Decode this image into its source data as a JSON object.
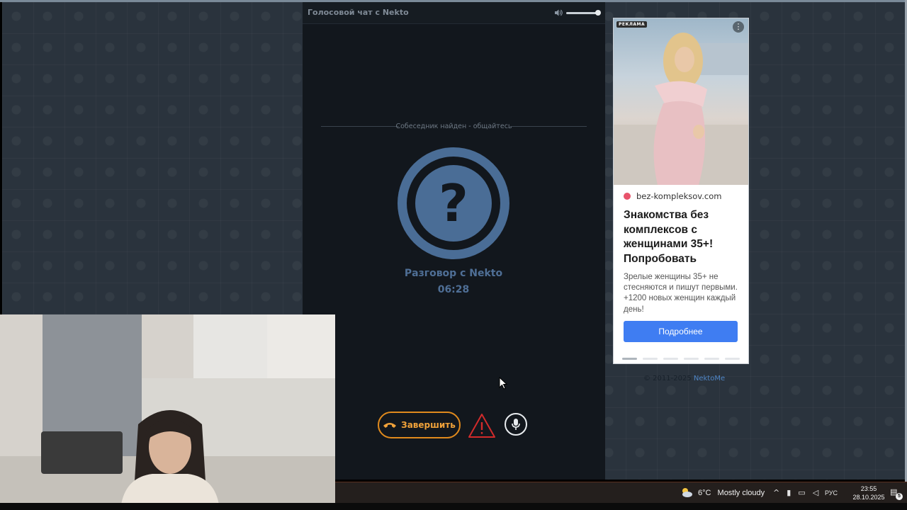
{
  "chat": {
    "title": "Голосовой чат с Nekto",
    "status": "Собеседник найден - общайтесь",
    "avatar_symbol": "?",
    "conversation_title": "Разговор с Nekto",
    "timer": "06:28",
    "volume": 0.9,
    "end_button": "Завершить",
    "accent_color": "#4f6f96",
    "end_color": "#e08a1d",
    "warn_color": "#d12b2b"
  },
  "ad": {
    "label": "РЕКЛАМА",
    "domain": "bez-kompleksov.com",
    "headline": "Знакомства без комплексов с женщинами 35+! Попробовать",
    "body": "Зрелые женщины 35+ не стесняются и пишут первыми. +1200 новых женщин каждый день!",
    "cta": "Подробнее",
    "slides": 6,
    "active_slide": 1
  },
  "footer": {
    "copyright": "© 2011-2025",
    "brand": "NektoMe"
  },
  "taskbar": {
    "temperature": "6°C",
    "weather": "Mostly cloudy",
    "language": "РУС",
    "time": "23:55",
    "date": "28.10.2025",
    "notifications": "5"
  },
  "icons": [
    "volume-icon",
    "phone-hangup-icon",
    "warning-icon",
    "microphone-icon",
    "cloud-icon",
    "chevron-up-icon",
    "notification-icon"
  ]
}
